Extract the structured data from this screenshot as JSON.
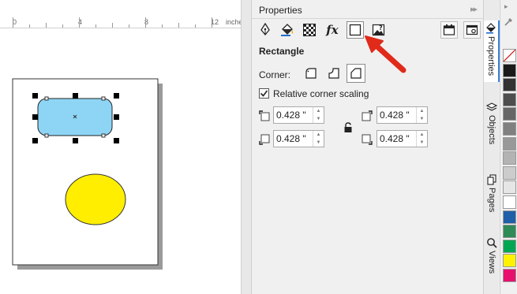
{
  "ruler": {
    "labels": [
      "0",
      "4",
      "8",
      "12"
    ],
    "unit": "inches"
  },
  "panel": {
    "title": "Properties",
    "expand_glyph": "▸▸"
  },
  "toolbar": {
    "buttons": [
      {
        "name": "outline-pen-tab",
        "icon": "pen-nib-icon"
      },
      {
        "name": "fill-tab",
        "icon": "paint-bucket-icon"
      },
      {
        "name": "transparency-tab",
        "icon": "checkerboard-icon"
      },
      {
        "name": "effects-tab",
        "icon": "fx-icon",
        "text": "fx"
      },
      {
        "name": "rectangle-tab",
        "icon": "rectangle-icon",
        "active": true
      },
      {
        "name": "bitmap-tab",
        "icon": "image-question-icon"
      },
      {
        "name": "frame-tab",
        "icon": "frame-icon"
      },
      {
        "name": "options-tab",
        "icon": "options-icon"
      }
    ]
  },
  "rectangle": {
    "section_title": "Rectangle",
    "corner_label": "Corner:",
    "corner_types": [
      "round-corner-icon",
      "scalloped-corner-icon",
      "chamfered-corner-icon"
    ],
    "relative_scaling_label": "Relative corner scaling",
    "relative_scaling_checked": true,
    "radius_top_left": "0.428 \"",
    "radius_top_right": "0.428 \"",
    "radius_bottom_left": "0.428 \"",
    "radius_bottom_right": "0.428 \""
  },
  "dockers": {
    "tabs": [
      "Properties",
      "Objects",
      "Pages",
      "Views"
    ]
  },
  "palette": {
    "colors": [
      "#ffffff",
      "#1a1a1a",
      "#333333",
      "#4d4d4d",
      "#666666",
      "#808080",
      "#999999",
      "#b3b3b3",
      "#cccccc",
      "#e6e6e6",
      "#ffffff",
      "#1f5fa8",
      "#2e8b57",
      "#00a651",
      "#fff200",
      "#e8106e"
    ]
  },
  "accent_colors": {
    "shape_fill": "#8ed5f5",
    "ellipse_fill": "#ffee00",
    "arrow": "#e02a1a",
    "active_tab": "#3b7fd9"
  }
}
